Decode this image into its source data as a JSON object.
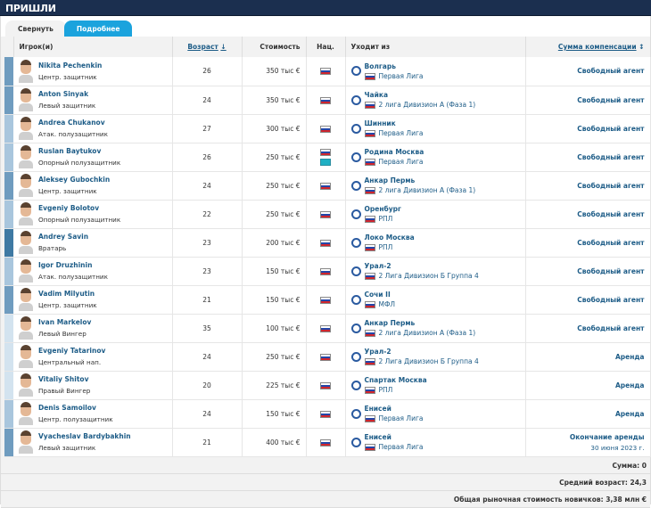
{
  "title": "ПРИШЛИ",
  "tabs": {
    "collapse": "Свернуть",
    "details": "Подробнее"
  },
  "headers": {
    "player": "Игрок(и)",
    "age": "Возраст",
    "age_sort": "↓",
    "value": "Стоимость",
    "nat": "Нац.",
    "from": "Уходит из",
    "fee": "Сумма компенсации",
    "fee_sort": "↕"
  },
  "position_colors": {
    "def": "#6f9cbf",
    "mid": "#a9c6dd",
    "gk": "#3e79a3",
    "fwd": "#d3e3ef"
  },
  "rows": [
    {
      "name": "Nikita Pechenkin",
      "position": "Центр. защитник",
      "group": "def",
      "age": "26",
      "value": "350 тыс €",
      "flags": [
        "ru"
      ],
      "club": "Волгарь",
      "league": "Первая Лига",
      "fee": "Свободный агент"
    },
    {
      "name": "Anton Sinyak",
      "position": "Левый защитник",
      "group": "def",
      "age": "24",
      "value": "350 тыс €",
      "flags": [
        "ru"
      ],
      "club": "Чайка",
      "league": "2 лига Дивизион А (Фаза 1)",
      "fee": "Свободный агент"
    },
    {
      "name": "Andrea Chukanov",
      "position": "Атак. полузащитник",
      "group": "mid",
      "age": "27",
      "value": "300 тыс €",
      "flags": [
        "ru"
      ],
      "club": "Шинник",
      "league": "Первая Лига",
      "fee": "Свободный агент"
    },
    {
      "name": "Ruslan Baytukov",
      "position": "Опорный полузащитник",
      "group": "mid",
      "age": "26",
      "value": "250 тыс €",
      "flags": [
        "ru",
        "kz"
      ],
      "club": "Родина Москва",
      "league": "Первая Лига",
      "fee": "Свободный агент"
    },
    {
      "name": "Aleksey Gubochkin",
      "position": "Центр. защитник",
      "group": "def",
      "age": "24",
      "value": "250 тыс €",
      "flags": [
        "ru"
      ],
      "club": "Анкар Пермь",
      "league": "2 лига Дивизион А (Фаза 1)",
      "fee": "Свободный агент"
    },
    {
      "name": "Evgeniy Bolotov",
      "position": "Опорный полузащитник",
      "group": "mid",
      "age": "22",
      "value": "250 тыс €",
      "flags": [
        "ru"
      ],
      "club": "Оренбург",
      "league": "РПЛ",
      "fee": "Свободный агент"
    },
    {
      "name": "Andrey Savin",
      "position": "Вратарь",
      "group": "gk",
      "age": "23",
      "value": "200 тыс €",
      "flags": [
        "ru"
      ],
      "club": "Локо Москва",
      "league": "РПЛ",
      "fee": "Свободный агент"
    },
    {
      "name": "Igor Druzhinin",
      "position": "Атак. полузащитник",
      "group": "mid",
      "age": "23",
      "value": "150 тыс €",
      "flags": [
        "ru"
      ],
      "club": "Урал-2",
      "league": "2 Лига Дивизион Б Группа 4",
      "fee": "Свободный агент"
    },
    {
      "name": "Vadim Milyutin",
      "position": "Центр. защитник",
      "group": "def",
      "age": "21",
      "value": "150 тыс €",
      "flags": [
        "ru"
      ],
      "club": "Сочи II",
      "league": "МФЛ",
      "fee": "Свободный агент"
    },
    {
      "name": "Ivan Markelov",
      "position": "Левый Вингер",
      "group": "fwd",
      "age": "35",
      "value": "100 тыс €",
      "flags": [
        "ru"
      ],
      "club": "Анкар Пермь",
      "league": "2 лига Дивизион А (Фаза 1)",
      "fee": "Свободный агент"
    },
    {
      "name": "Evgeniy Tatarinov",
      "position": "Центральный нап.",
      "group": "fwd",
      "age": "24",
      "value": "250 тыс €",
      "flags": [
        "ru"
      ],
      "club": "Урал-2",
      "league": "2 Лига Дивизион Б Группа 4",
      "fee": "Аренда"
    },
    {
      "name": "Vitaliy Shitov",
      "position": "Правый Вингер",
      "group": "fwd",
      "age": "20",
      "value": "225 тыс €",
      "flags": [
        "ru"
      ],
      "club": "Спартак Москва",
      "league": "РПЛ",
      "fee": "Аренда"
    },
    {
      "name": "Denis Samoilov",
      "position": "Центр. полузащитник",
      "group": "mid",
      "age": "24",
      "value": "150 тыс €",
      "flags": [
        "ru"
      ],
      "club": "Енисей",
      "league": "Первая Лига",
      "fee": "Аренда"
    },
    {
      "name": "Vyacheslav Bardybakhin",
      "position": "Левый защитник",
      "group": "def",
      "age": "21",
      "value": "400 тыс €",
      "flags": [
        "ru"
      ],
      "club": "Енисей",
      "league": "Первая Лига",
      "fee": "Окончание аренды",
      "fee_date": "30 июня 2023 г."
    }
  ],
  "summary": {
    "sum": "Сумма: 0",
    "avg_age": "Средний возраст: 24,3",
    "total_value": "Общая рыночная стоимость новичков: 3,38 млн €"
  }
}
